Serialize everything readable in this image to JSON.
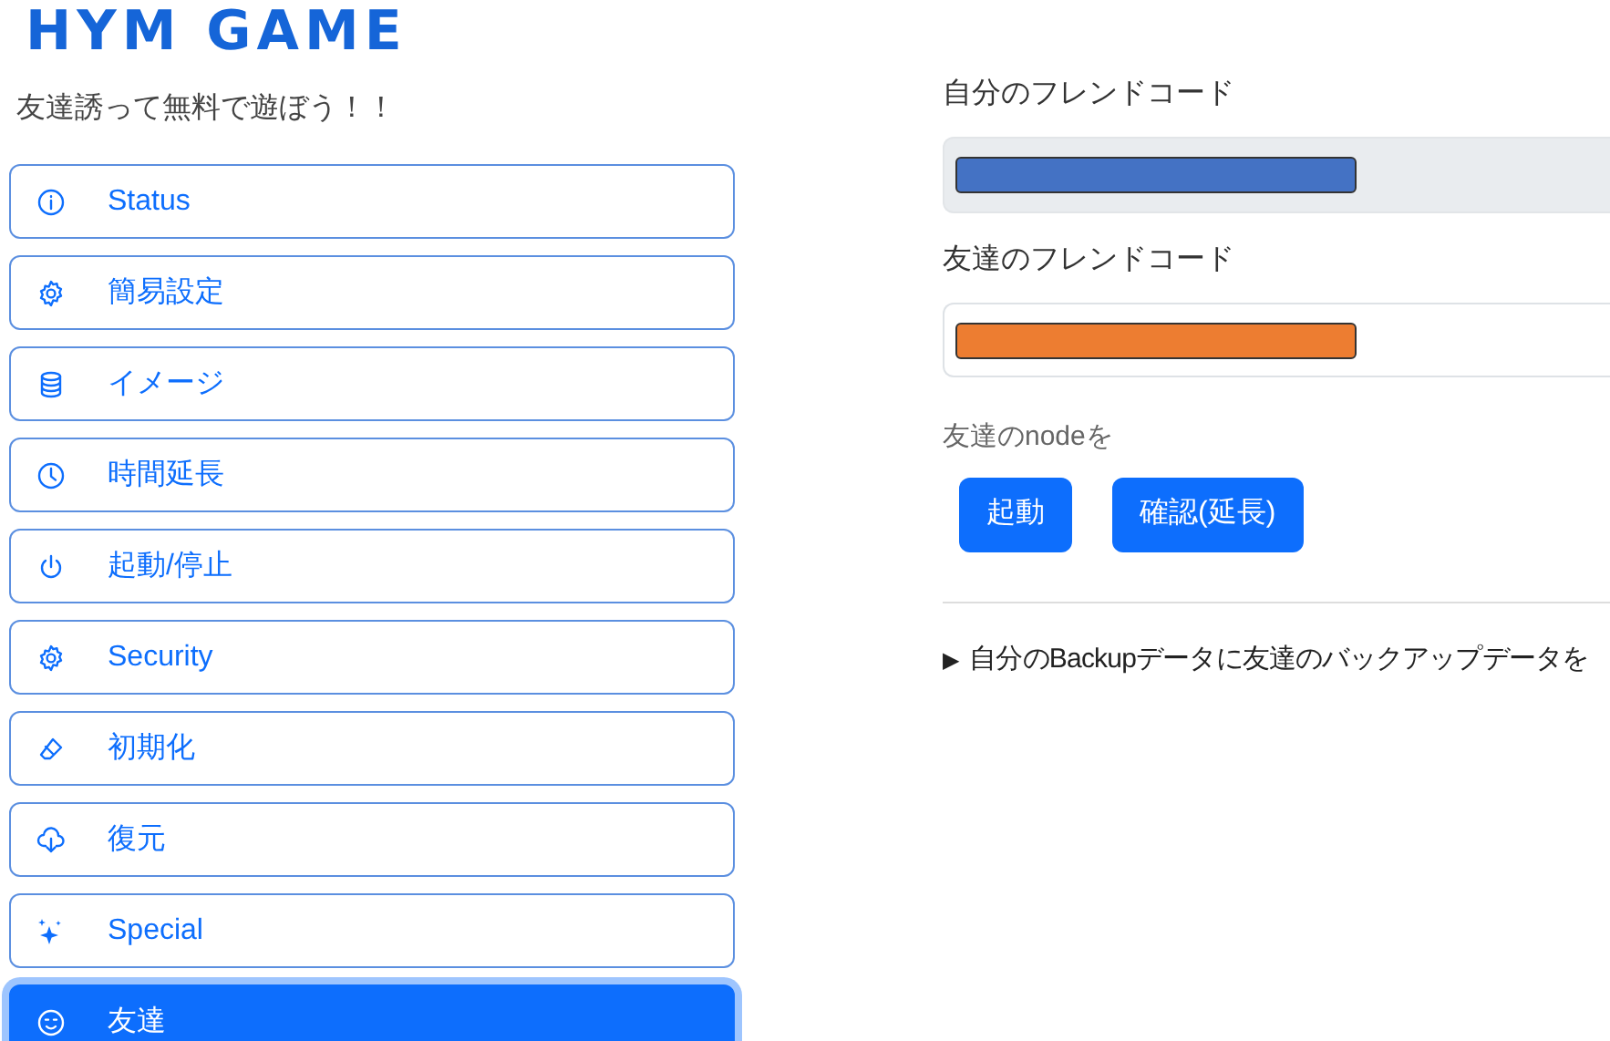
{
  "logo": "HYM GAME",
  "tagline": "友達誘って無料で遊ぼう！！",
  "menu": [
    {
      "label": "Status",
      "selected": false
    },
    {
      "label": "簡易設定",
      "selected": false
    },
    {
      "label": "イメージ",
      "selected": false
    },
    {
      "label": "時間延長",
      "selected": false
    },
    {
      "label": "起動/停止",
      "selected": false
    },
    {
      "label": "Security",
      "selected": false
    },
    {
      "label": "初期化",
      "selected": false
    },
    {
      "label": "復元",
      "selected": false
    },
    {
      "label": "Special",
      "selected": false
    },
    {
      "label": "友達",
      "selected": true
    }
  ],
  "fields": [
    {
      "label": "自分のフレンドコード",
      "readonly": true,
      "color": "#4472c4"
    },
    {
      "label": "友達のフレンドコード",
      "readonly": false,
      "color": "#ed7d31"
    }
  ],
  "node_label": "友達のnodeを",
  "buttons": [
    "起動",
    "確認(延長)"
  ],
  "details": {
    "marker": "▶",
    "summary": "自分のBackupデータに友達のバックアップデータを"
  }
}
